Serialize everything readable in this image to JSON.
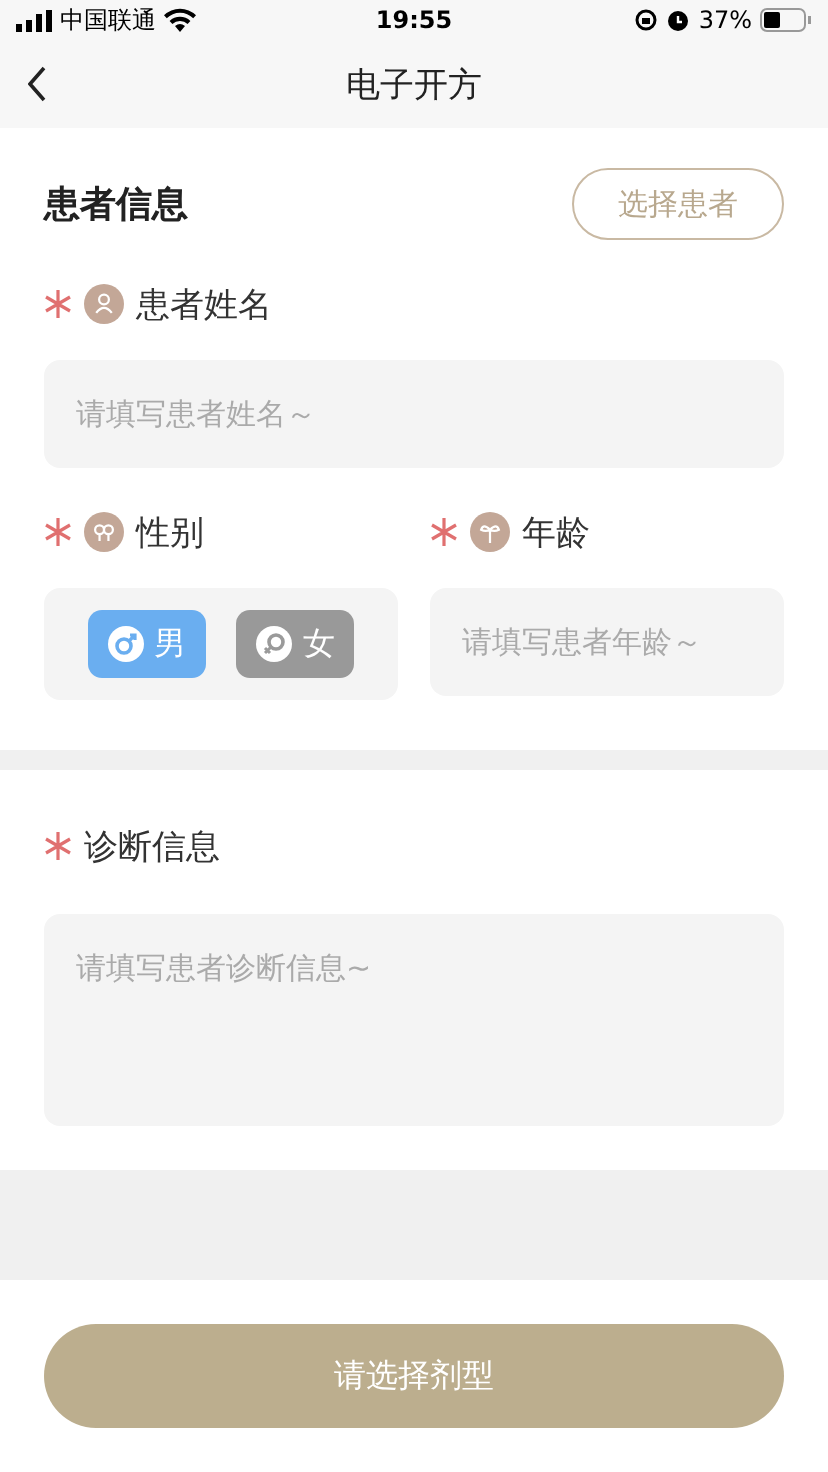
{
  "status_bar": {
    "carrier": "中国联通",
    "time": "19:55",
    "battery": "37%"
  },
  "nav": {
    "title": "电子开方"
  },
  "patient_section": {
    "title": "患者信息",
    "select_button": "选择患者",
    "name_field": {
      "label": "患者姓名",
      "required": true,
      "placeholder": "请填写患者姓名～"
    },
    "gender_field": {
      "label": "性别",
      "required": true,
      "options": [
        {
          "label": "男",
          "kind": "male",
          "selected": true
        },
        {
          "label": "女",
          "kind": "female",
          "selected": false
        }
      ]
    },
    "age_field": {
      "label": "年龄",
      "required": true,
      "placeholder": "请填写患者年龄～"
    }
  },
  "diagnosis_section": {
    "label": "诊断信息",
    "required": true,
    "placeholder": "请填写患者诊断信息~"
  },
  "submit_button": "请选择剂型"
}
